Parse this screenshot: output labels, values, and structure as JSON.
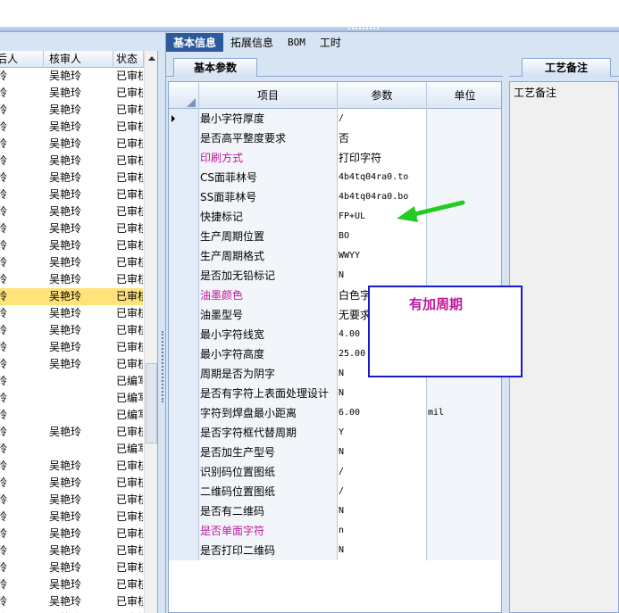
{
  "left_table": {
    "headers": [
      "后人",
      "核审人",
      "状态"
    ],
    "rows": [
      [
        "玲",
        "吴艳玲",
        "已审核"
      ],
      [
        "玲",
        "吴艳玲",
        "已审核"
      ],
      [
        "玲",
        "吴艳玲",
        "已审核"
      ],
      [
        "玲",
        "吴艳玲",
        "已审核"
      ],
      [
        "玲",
        "吴艳玲",
        "已审核"
      ],
      [
        "玲",
        "吴艳玲",
        "已审核"
      ],
      [
        "玲",
        "吴艳玲",
        "已审核"
      ],
      [
        "玲",
        "吴艳玲",
        "已审核"
      ],
      [
        "玲",
        "吴艳玲",
        "已审核"
      ],
      [
        "玲",
        "吴艳玲",
        "已审核"
      ],
      [
        "玲",
        "吴艳玲",
        "已审核"
      ],
      [
        "玲",
        "吴艳玲",
        "已审核"
      ],
      [
        "玲",
        "吴艳玲",
        "已审核"
      ],
      [
        "玲",
        "吴艳玲",
        "已审核"
      ],
      [
        "玲",
        "吴艳玲",
        "已审核"
      ],
      [
        "玲",
        "吴艳玲",
        "已审核"
      ],
      [
        "玲",
        "吴艳玲",
        "已审核"
      ],
      [
        "玲",
        "吴艳玲",
        "已审核"
      ],
      [
        "玲",
        "",
        "已编写"
      ],
      [
        "玲",
        "",
        "已编写"
      ],
      [
        "玲",
        "",
        "已编写"
      ],
      [
        "玲",
        "吴艳玲",
        "已审核"
      ],
      [
        "玲",
        "",
        "已编写"
      ],
      [
        "玲",
        "吴艳玲",
        "已审核"
      ],
      [
        "玲",
        "吴艳玲",
        "已审核"
      ],
      [
        "玲",
        "吴艳玲",
        "已审核"
      ],
      [
        "玲",
        "吴艳玲",
        "已审核"
      ],
      [
        "玲",
        "吴艳玲",
        "已审核"
      ],
      [
        "玲",
        "吴艳玲",
        "已审核"
      ],
      [
        "玲",
        "吴艳玲",
        "已审核"
      ],
      [
        "玲",
        "吴艳玲",
        "已审核"
      ],
      [
        "玲",
        "吴艳玲",
        "已审核"
      ],
      [
        "玲",
        "吴艳玲",
        "已审核"
      ]
    ],
    "selected_row": 13
  },
  "tabs": [
    "基本信息",
    "拓展信息",
    "BOM",
    "工时"
  ],
  "active_tab": "基本信息",
  "sub_tab": "基本参数",
  "grid": {
    "headers": [
      "项目",
      "参数",
      "单位"
    ],
    "rows": [
      {
        "item": "最小字符厚度",
        "param": "/",
        "unit": "",
        "highlight": false
      },
      {
        "item": "是否高平整度要求",
        "param": "否",
        "unit": "",
        "highlight": false
      },
      {
        "item": "印刷方式",
        "param": "打印字符",
        "unit": "",
        "highlight": true
      },
      {
        "item": "CS面菲林号",
        "param": "4b4tq04ra0.to",
        "unit": "",
        "highlight": false
      },
      {
        "item": "SS面菲林号",
        "param": "4b4tq04ra0.bo",
        "unit": "",
        "highlight": false
      },
      {
        "item": "快捷标记",
        "param": "FP+UL",
        "unit": "",
        "highlight": false
      },
      {
        "item": "生产周期位置",
        "param": "BO",
        "unit": "",
        "highlight": false
      },
      {
        "item": "生产周期格式",
        "param": "WWYY",
        "unit": "",
        "highlight": false
      },
      {
        "item": "是否加无铅标记",
        "param": "N",
        "unit": "",
        "highlight": false
      },
      {
        "item": "油墨颜色",
        "param": "白色字",
        "unit": "",
        "highlight": true
      },
      {
        "item": "油墨型号",
        "param": "无要求",
        "unit": "",
        "highlight": false
      },
      {
        "item": "最小字符线宽",
        "param": "4.00",
        "unit": "",
        "highlight": false
      },
      {
        "item": "最小字符高度",
        "param": "25.00",
        "unit": "",
        "highlight": false
      },
      {
        "item": "周期是否为阴字",
        "param": "N",
        "unit": "",
        "highlight": false
      },
      {
        "item": "是否有字符上表面处理设计",
        "param": "N",
        "unit": "",
        "highlight": false
      },
      {
        "item": "字符到焊盘最小距离",
        "param": "6.00",
        "unit": "mil",
        "highlight": false
      },
      {
        "item": "是否字符框代替周期",
        "param": "Y",
        "unit": "",
        "highlight": false
      },
      {
        "item": "是否加生产型号",
        "param": "N",
        "unit": "",
        "highlight": false
      },
      {
        "item": "识别码位置图纸",
        "param": "/",
        "unit": "",
        "highlight": false
      },
      {
        "item": "二维码位置图纸",
        "param": "/",
        "unit": "",
        "highlight": false
      },
      {
        "item": "是否有二维码",
        "param": "N",
        "unit": "",
        "highlight": false
      },
      {
        "item": "是否单面字符",
        "param": "n",
        "unit": "",
        "highlight": true
      },
      {
        "item": "是否打印二维码",
        "param": "N",
        "unit": "",
        "highlight": false
      }
    ]
  },
  "right_panel": {
    "tab": "工艺备注",
    "label": "工艺备注"
  },
  "annotation": {
    "text": "有加周期",
    "arrow_color": "#22cc22",
    "box_color": "#1d1ac8",
    "text_color": "#c0179c"
  }
}
